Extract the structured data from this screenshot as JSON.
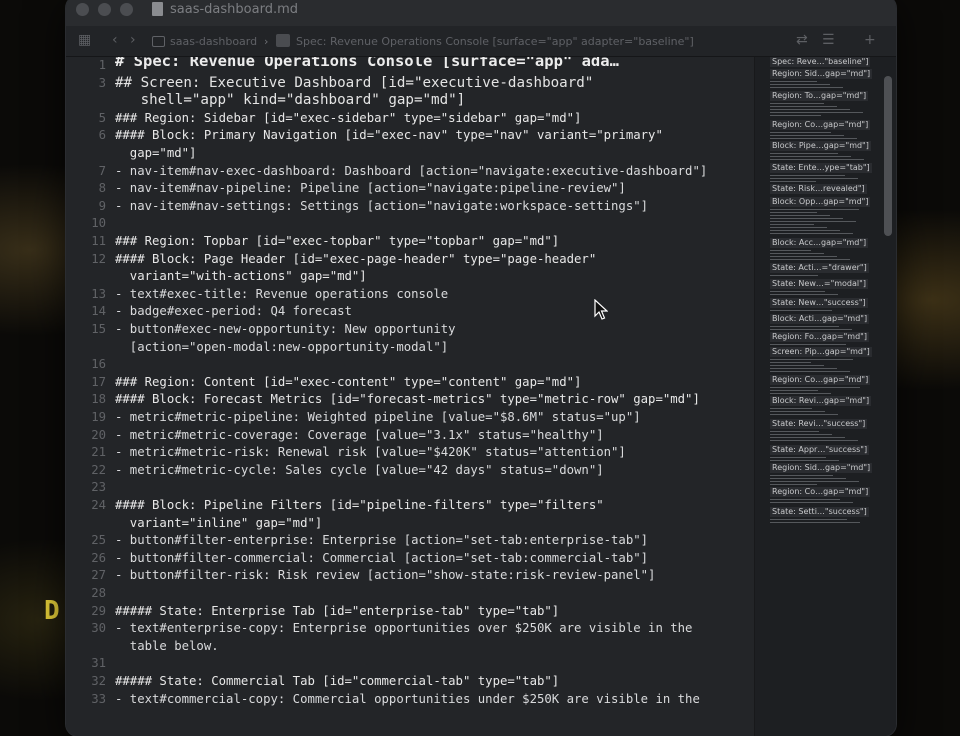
{
  "window": {
    "file_name": "saas-dashboard.md",
    "breadcrumb": [
      "saas-dashboard",
      "Spec: Revenue Operations Console [surface=\"app\" adapter=\"baseline\"]"
    ]
  },
  "lines": [
    {
      "n": "1",
      "text": "# Spec: Revenue Operations Console [surface=\"app\" ada…",
      "kind": "h1"
    },
    {
      "n": "3",
      "text": "## Screen: Executive Dashboard [id=\"executive-dashboard\"",
      "kind": "h2"
    },
    {
      "n": "",
      "text": "   shell=\"app\" kind=\"dashboard\" gap=\"md\"]",
      "kind": "h2"
    },
    {
      "n": "5",
      "text": "### Region: Sidebar [id=\"exec-sidebar\" type=\"sidebar\" gap=\"md\"]",
      "kind": "hdr"
    },
    {
      "n": "6",
      "text": "#### Block: Primary Navigation [id=\"exec-nav\" type=\"nav\" variant=\"primary\"",
      "kind": "hdr"
    },
    {
      "n": "",
      "text": "  gap=\"md\"]",
      "kind": "hdr"
    },
    {
      "n": "7",
      "text": "- nav-item#nav-exec-dashboard: Dashboard [action=\"navigate:executive-dashboard\"]",
      "kind": "item"
    },
    {
      "n": "8",
      "text": "- nav-item#nav-pipeline: Pipeline [action=\"navigate:pipeline-review\"]",
      "kind": "item"
    },
    {
      "n": "9",
      "text": "- nav-item#nav-settings: Settings [action=\"navigate:workspace-settings\"]",
      "kind": "item"
    },
    {
      "n": "10",
      "text": "",
      "kind": "blank"
    },
    {
      "n": "11",
      "text": "### Region: Topbar [id=\"exec-topbar\" type=\"topbar\" gap=\"md\"]",
      "kind": "hdr"
    },
    {
      "n": "12",
      "text": "#### Block: Page Header [id=\"exec-page-header\" type=\"page-header\"",
      "kind": "hdr"
    },
    {
      "n": "",
      "text": "  variant=\"with-actions\" gap=\"md\"]",
      "kind": "hdr"
    },
    {
      "n": "13",
      "text": "- text#exec-title: Revenue operations console",
      "kind": "item"
    },
    {
      "n": "14",
      "text": "- badge#exec-period: Q4 forecast",
      "kind": "item"
    },
    {
      "n": "15",
      "text": "- button#exec-new-opportunity: New opportunity",
      "kind": "item"
    },
    {
      "n": "",
      "text": "  [action=\"open-modal:new-opportunity-modal\"]",
      "kind": "item"
    },
    {
      "n": "16",
      "text": "",
      "kind": "blank"
    },
    {
      "n": "17",
      "text": "### Region: Content [id=\"exec-content\" type=\"content\" gap=\"md\"]",
      "kind": "hdr"
    },
    {
      "n": "18",
      "text": "#### Block: Forecast Metrics [id=\"forecast-metrics\" type=\"metric-row\" gap=\"md\"]",
      "kind": "hdr"
    },
    {
      "n": "19",
      "text": "- metric#metric-pipeline: Weighted pipeline [value=\"$8.6M\" status=\"up\"]",
      "kind": "item"
    },
    {
      "n": "20",
      "text": "- metric#metric-coverage: Coverage [value=\"3.1x\" status=\"healthy\"]",
      "kind": "item"
    },
    {
      "n": "21",
      "text": "- metric#metric-risk: Renewal risk [value=\"$420K\" status=\"attention\"]",
      "kind": "item"
    },
    {
      "n": "22",
      "text": "- metric#metric-cycle: Sales cycle [value=\"42 days\" status=\"down\"]",
      "kind": "item"
    },
    {
      "n": "23",
      "text": "",
      "kind": "blank"
    },
    {
      "n": "24",
      "text": "#### Block: Pipeline Filters [id=\"pipeline-filters\" type=\"filters\"",
      "kind": "hdr"
    },
    {
      "n": "",
      "text": "  variant=\"inline\" gap=\"md\"]",
      "kind": "hdr"
    },
    {
      "n": "25",
      "text": "- button#filter-enterprise: Enterprise [action=\"set-tab:enterprise-tab\"]",
      "kind": "item"
    },
    {
      "n": "26",
      "text": "- button#filter-commercial: Commercial [action=\"set-tab:commercial-tab\"]",
      "kind": "item"
    },
    {
      "n": "27",
      "text": "- button#filter-risk: Risk review [action=\"show-state:risk-review-panel\"]",
      "kind": "item"
    },
    {
      "n": "28",
      "text": "",
      "kind": "blank"
    },
    {
      "n": "29",
      "text": "##### State: Enterprise Tab [id=\"enterprise-tab\" type=\"tab\"]",
      "kind": "hdr"
    },
    {
      "n": "30",
      "text": "- text#enterprise-copy: Enterprise opportunities over $250K are visible in the",
      "kind": "item"
    },
    {
      "n": "",
      "text": "  table below.",
      "kind": "item"
    },
    {
      "n": "31",
      "text": "",
      "kind": "blank"
    },
    {
      "n": "32",
      "text": "##### State: Commercial Tab [id=\"commercial-tab\" type=\"tab\"]",
      "kind": "hdr"
    },
    {
      "n": "33",
      "text": "- text#commercial-copy: Commercial opportunities under $250K are visible in the",
      "kind": "item"
    }
  ],
  "minimap": [
    "Spec: Reve…\"baseline\"]",
    "Region: Sid…gap=\"md\"]",
    "Region: To…gap=\"md\"]",
    "Region: Co…gap=\"md\"]",
    "Block: Pipe…gap=\"md\"]",
    "State: Ente…ype=\"tab\"]",
    "State: Risk…revealed\"]",
    "Block: Opp…gap=\"md\"]",
    "Block: Acc…gap=\"md\"]",
    "State: Acti…=\"drawer\"]",
    "State: New…=\"modal\"]",
    "State: New…\"success\"]",
    "Block: Acti…gap=\"md\"]",
    "Region: Fo…gap=\"md\"]",
    "Screen: Pip…gap=\"md\"]",
    "Region: Co…gap=\"md\"]",
    "Block: Revi…gap=\"md\"]",
    "State: Revi…\"success\"]",
    "State: Appr…\"success\"]",
    "Region: Sid…gap=\"md\"]",
    "Region: Co…gap=\"md\"]",
    "State: Setti…\"success\"]"
  ],
  "side_glyph": "D"
}
